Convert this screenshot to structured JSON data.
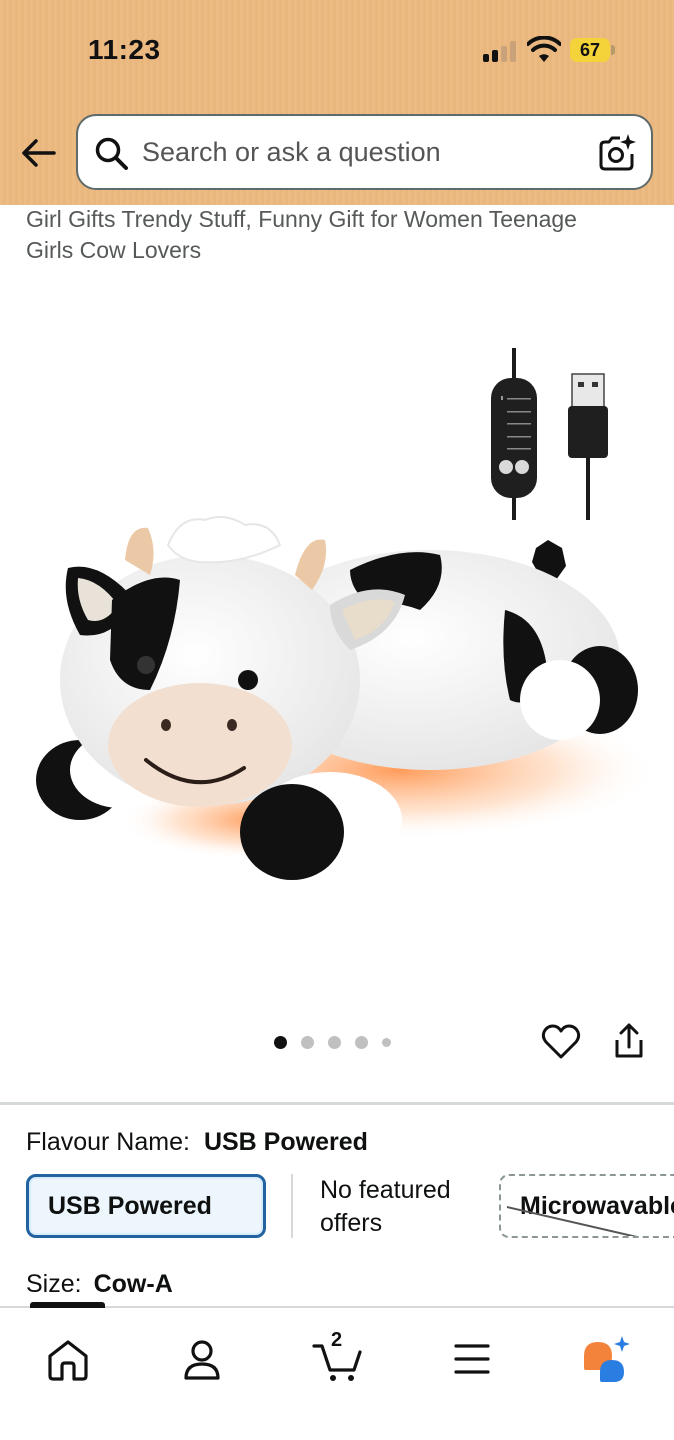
{
  "status_bar": {
    "time": "11:23",
    "battery": "67",
    "battery_color": "#f4d23a"
  },
  "search": {
    "placeholder": "Search or ask a question"
  },
  "product": {
    "title_line1": "Girl Gifts Trendy Stuff, Funny Gift for Women Teenage",
    "title_line2": "Girls Cow Lovers"
  },
  "gallery": {
    "image_count": 5,
    "active_index": 0
  },
  "variations": {
    "flavour_label": "Flavour Name:",
    "flavour_value": "USB Powered",
    "options": [
      {
        "label": "USB Powered",
        "state": "selected"
      },
      {
        "label": "No featured offers",
        "state": "note"
      },
      {
        "label": "Microwavable",
        "state": "unavailable"
      }
    ],
    "size_label": "Size:",
    "size_value": "Cow-A"
  },
  "bottom_nav": {
    "items": [
      "home-icon",
      "account-icon",
      "cart-icon",
      "menu-icon",
      "rufus-icon"
    ],
    "cart_count": "2"
  },
  "colors": {
    "header_bg": "#ecbb84",
    "selected_border": "#2162a1",
    "rufus_orange": "#f3823a",
    "rufus_blue": "#2a7de1"
  }
}
